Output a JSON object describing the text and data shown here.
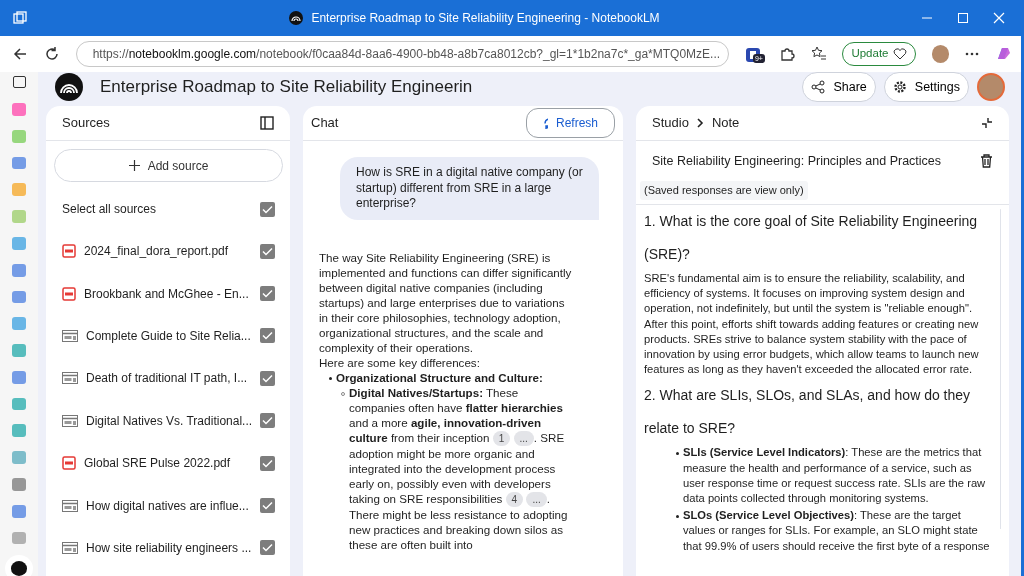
{
  "window": {
    "title": "Enterprise Roadmap to Site Reliability Engineering - NotebookLM"
  },
  "browser": {
    "url": "https://**notebooklm.google.com**/notebook/f0caa84d-8aa6-4900-bb48-a8b7ca8012cb?_gl=1*1b2na7c*_ga*MTQ0MzE...",
    "extension_badge": "9+",
    "update_label": "Update"
  },
  "notebook": {
    "title": "Enterprise Roadmap to Site Reliability Engineerin",
    "share": "Share",
    "settings": "Settings"
  },
  "sources": {
    "title": "Sources",
    "add_source": "Add source",
    "select_all": {
      "label": "Select all sources",
      "checked": true
    },
    "items": [
      {
        "name": "2024_final_dora_report.pdf",
        "kind": "pdf",
        "checked": true
      },
      {
        "name": "Brookbank and McGhee - En...",
        "kind": "pdf",
        "checked": true
      },
      {
        "name": "Complete Guide to Site Relia...",
        "kind": "web",
        "checked": true
      },
      {
        "name": "Death of traditional IT path, I...",
        "kind": "web",
        "checked": true
      },
      {
        "name": "Digital Natives Vs. Traditional...",
        "kind": "web",
        "checked": true
      },
      {
        "name": "Global SRE Pulse 2022.pdf",
        "kind": "pdf",
        "checked": true
      },
      {
        "name": "How digital natives are influe...",
        "kind": "web",
        "checked": true
      },
      {
        "name": "How site reliability engineers ...",
        "kind": "web",
        "checked": true
      }
    ]
  },
  "chat": {
    "title": "Chat",
    "refresh": "Refresh",
    "question": "How is SRE in a digital native company (or startup) different from SRE in a large enterprise?",
    "intro": "The way Site Reliability Engineering (SRE) is implemented and functions can differ significantly between digital native companies (including startups) and large enterprises due to variations in their core philosophies, technology adoption, organizational structures, and the scale and complexity of their operations.",
    "lead": "Here are some key differences:",
    "bullet": "Organizational Structure and Culture:",
    "sub_bullet": [
      {
        "kind": "text",
        "text": "**Digital Natives/Startups:** These companies often have **flatter hierarchies** and a more **agile, innovation-driven culture** from their inception"
      },
      {
        "kind": "cite",
        "text": "1"
      },
      {
        "kind": "cite",
        "text": "..."
      },
      {
        "kind": "text",
        "text": ". SRE adoption might be more organic and integrated into the development process early on, possibly even with developers taking on SRE responsibilities"
      },
      {
        "kind": "cite",
        "text": "4"
      },
      {
        "kind": "cite",
        "text": "..."
      },
      {
        "kind": "text",
        "text": ". There might be less resistance to adopting new practices and breaking down silos as these are often built into"
      }
    ]
  },
  "studio": {
    "crumbs": [
      "Studio",
      "Note"
    ],
    "note_title": "Site Reliability Engineering: Principles and Practices",
    "notice": "(Saved responses are view only)",
    "blocks": [
      {
        "kind": "heading",
        "text": "1. What is the core goal of Site Reliability Engineering (SRE)?"
      },
      {
        "kind": "para",
        "text": "SRE's fundamental aim is to ensure the reliability, scalability, and efficiency of systems. It focuses on improving system design and operation, not indefinitely, but until the system is \"reliable enough\". After this point, efforts shift towards adding features or creating new products. SREs strive to balance system stability with the pace of innovation by using error budgets, which allow teams to launch new features as long as they haven't exceeded the allocated error rate."
      },
      {
        "kind": "heading",
        "text": "2. What are SLIs, SLOs, and SLAs, and how do they relate to SRE?"
      },
      {
        "kind": "bullet",
        "text": "**SLIs (Service Level Indicators)**: These are the metrics that measure the health and performance of a service, such as user response time or request success rate. SLIs are the raw data points collected through monitoring systems."
      },
      {
        "kind": "bullet",
        "text": "**SLOs (Service Level Objectives)**: These are the target values or ranges for SLIs. For example, an SLO might state that 99.9% of users should receive the first byte of a response"
      }
    ]
  }
}
